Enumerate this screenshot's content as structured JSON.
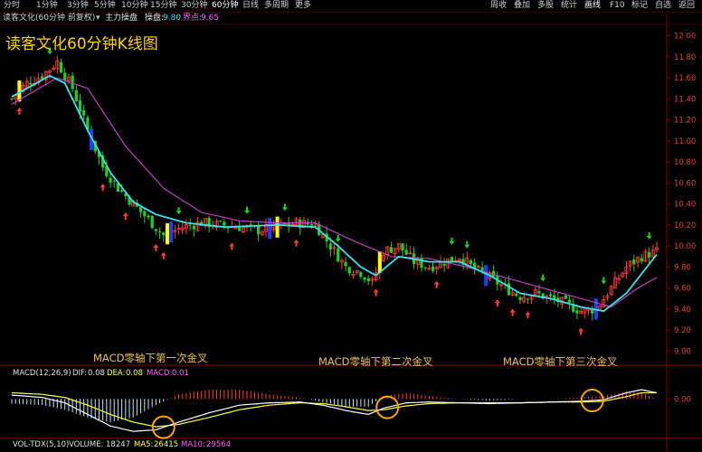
{
  "toolbar": {
    "left_tabs": [
      "分时",
      "1分钟",
      "3分钟",
      "5分钟",
      "10分钟",
      "15分钟",
      "30分钟",
      "60分钟",
      "日线",
      "多周期",
      "更多"
    ],
    "active_left": "60分钟",
    "right_tabs": [
      "周收",
      "叠加",
      "多股",
      "统计",
      "画线",
      "F10",
      "标记",
      "自选",
      "返回"
    ],
    "active_right": "画线"
  },
  "subheader": {
    "stock_desc": "读客文化(60分钟 前复权)",
    "indicator": "主力操盘",
    "op_label": "操盘:",
    "op_value": "9.80",
    "boundary_label": "界点:",
    "boundary_value": "9.65"
  },
  "overlay_title": "读客文化60分钟K线图",
  "annotations": {
    "first": "MACD零轴下第一次金叉",
    "second": "MACD零轴下第二次金叉",
    "third": "MACD零轴下第三次金叉"
  },
  "macd_header": {
    "name": "MACD(12,26,9)",
    "dif_label": "DIF:",
    "dif_value": "0.08",
    "dea_label": "DEA:",
    "dea_value": "0.08",
    "macd_label": "MACD:",
    "macd_value": "0.01"
  },
  "vol_header": {
    "name": "VOL-TDX(5,10)",
    "volume_label": "VOLUME:",
    "volume_value": "18247",
    "ma5_label": "MA5:",
    "ma5_value": "26415",
    "ma10_label": "MA10:",
    "ma10_value": "29564"
  },
  "colors": {
    "up": "#ff3c3c",
    "down": "#20d020",
    "ma_fast": "#40e0f0",
    "ma_slow": "#c040c0",
    "dif": "#ffffff",
    "dea": "#ffff40",
    "circle": "#ffa500",
    "highlight": "#ffff00",
    "neutral_bar": "#2040ff",
    "axis": "#8b0000",
    "tick_text": "#e04040"
  },
  "chart_data": [
    {
      "type": "candlestick",
      "title": "读客文化60分钟K线图",
      "ylim": [
        8.9,
        12.1
      ],
      "yticks": [
        9.0,
        9.2,
        9.4,
        9.6,
        9.8,
        10.0,
        10.2,
        10.4,
        10.6,
        10.8,
        11.0,
        11.2,
        11.4,
        11.6,
        11.8,
        12.0
      ],
      "ytick_labels": [
        "9.00",
        "9.20",
        "9.40",
        "9.60",
        "9.80",
        "10.00",
        "10.20",
        "10.40",
        "10.60",
        "10.80",
        "11.00",
        "11.20",
        "11.40",
        "11.60",
        "11.80",
        "12.00"
      ],
      "anchors": [
        [
          0,
          11.4
        ],
        [
          4,
          11.55
        ],
        [
          8,
          11.62
        ],
        [
          12,
          11.75
        ],
        [
          16,
          11.5
        ],
        [
          20,
          11.1
        ],
        [
          24,
          10.75
        ],
        [
          28,
          10.55
        ],
        [
          32,
          10.4
        ],
        [
          36,
          10.25
        ],
        [
          40,
          10.1
        ],
        [
          45,
          10.18
        ],
        [
          50,
          10.22
        ],
        [
          55,
          10.2
        ],
        [
          60,
          10.18
        ],
        [
          65,
          10.15
        ],
        [
          70,
          10.18
        ],
        [
          75,
          10.22
        ],
        [
          80,
          10.2
        ],
        [
          84,
          10.0
        ],
        [
          88,
          9.8
        ],
        [
          92,
          9.75
        ],
        [
          95,
          9.65
        ],
        [
          98,
          9.95
        ],
        [
          102,
          10.0
        ],
        [
          106,
          9.85
        ],
        [
          110,
          9.8
        ],
        [
          114,
          9.85
        ],
        [
          118,
          9.9
        ],
        [
          122,
          9.78
        ],
        [
          126,
          9.7
        ],
        [
          130,
          9.6
        ],
        [
          134,
          9.52
        ],
        [
          138,
          9.55
        ],
        [
          142,
          9.5
        ],
        [
          146,
          9.45
        ],
        [
          150,
          9.38
        ],
        [
          154,
          9.4
        ],
        [
          158,
          9.6
        ],
        [
          162,
          9.8
        ],
        [
          166,
          9.9
        ],
        [
          170,
          9.95
        ]
      ],
      "bar_count": 171,
      "ma_fast_anchors": [
        [
          0,
          11.42
        ],
        [
          10,
          11.62
        ],
        [
          14,
          11.55
        ],
        [
          20,
          11.1
        ],
        [
          26,
          10.7
        ],
        [
          32,
          10.42
        ],
        [
          38,
          10.3
        ],
        [
          46,
          10.22
        ],
        [
          56,
          10.18
        ],
        [
          70,
          10.2
        ],
        [
          80,
          10.18
        ],
        [
          86,
          10.0
        ],
        [
          92,
          9.8
        ],
        [
          96,
          9.72
        ],
        [
          102,
          9.9
        ],
        [
          110,
          9.85
        ],
        [
          118,
          9.85
        ],
        [
          126,
          9.72
        ],
        [
          134,
          9.55
        ],
        [
          142,
          9.5
        ],
        [
          150,
          9.42
        ],
        [
          156,
          9.38
        ],
        [
          162,
          9.55
        ],
        [
          170,
          9.92
        ]
      ],
      "ma_slow_anchors": [
        [
          0,
          11.35
        ],
        [
          12,
          11.6
        ],
        [
          20,
          11.5
        ],
        [
          30,
          10.95
        ],
        [
          40,
          10.55
        ],
        [
          50,
          10.32
        ],
        [
          60,
          10.24
        ],
        [
          70,
          10.22
        ],
        [
          80,
          10.22
        ],
        [
          90,
          10.05
        ],
        [
          100,
          9.9
        ],
        [
          110,
          9.88
        ],
        [
          120,
          9.8
        ],
        [
          130,
          9.7
        ],
        [
          140,
          9.6
        ],
        [
          150,
          9.5
        ],
        [
          158,
          9.42
        ],
        [
          165,
          9.6
        ],
        [
          170,
          9.7
        ]
      ]
    },
    {
      "type": "macd",
      "name": "MACD(12,26,9)",
      "ylim": [
        -0.5,
        0.25
      ],
      "yticks": [
        0.0
      ],
      "ytick_labels": [
        "0.00"
      ],
      "dif_anchors": [
        [
          0,
          0.05
        ],
        [
          8,
          0.02
        ],
        [
          14,
          -0.05
        ],
        [
          20,
          -0.2
        ],
        [
          26,
          -0.35
        ],
        [
          32,
          -0.42
        ],
        [
          38,
          -0.4
        ],
        [
          44,
          -0.3
        ],
        [
          52,
          -0.18
        ],
        [
          60,
          -0.08
        ],
        [
          68,
          -0.05
        ],
        [
          76,
          -0.04
        ],
        [
          82,
          -0.08
        ],
        [
          88,
          -0.15
        ],
        [
          94,
          -0.2
        ],
        [
          98,
          -0.12
        ],
        [
          104,
          -0.05
        ],
        [
          110,
          -0.04
        ],
        [
          118,
          -0.05
        ],
        [
          126,
          -0.06
        ],
        [
          134,
          -0.05
        ],
        [
          142,
          -0.04
        ],
        [
          150,
          -0.03
        ],
        [
          156,
          -0.01
        ],
        [
          162,
          0.08
        ],
        [
          166,
          0.12
        ],
        [
          170,
          0.08
        ]
      ],
      "dea_anchors": [
        [
          0,
          0.08
        ],
        [
          8,
          0.06
        ],
        [
          14,
          0.02
        ],
        [
          20,
          -0.08
        ],
        [
          26,
          -0.2
        ],
        [
          32,
          -0.3
        ],
        [
          38,
          -0.36
        ],
        [
          44,
          -0.33
        ],
        [
          52,
          -0.24
        ],
        [
          60,
          -0.14
        ],
        [
          68,
          -0.08
        ],
        [
          76,
          -0.05
        ],
        [
          82,
          -0.06
        ],
        [
          88,
          -0.1
        ],
        [
          94,
          -0.15
        ],
        [
          98,
          -0.14
        ],
        [
          104,
          -0.09
        ],
        [
          110,
          -0.06
        ],
        [
          118,
          -0.05
        ],
        [
          126,
          -0.05
        ],
        [
          134,
          -0.05
        ],
        [
          142,
          -0.04
        ],
        [
          150,
          -0.04
        ],
        [
          156,
          -0.03
        ],
        [
          162,
          0.03
        ],
        [
          166,
          0.08
        ],
        [
          170,
          0.08
        ]
      ],
      "golden_cross_bars": [
        40,
        99,
        153
      ]
    }
  ]
}
